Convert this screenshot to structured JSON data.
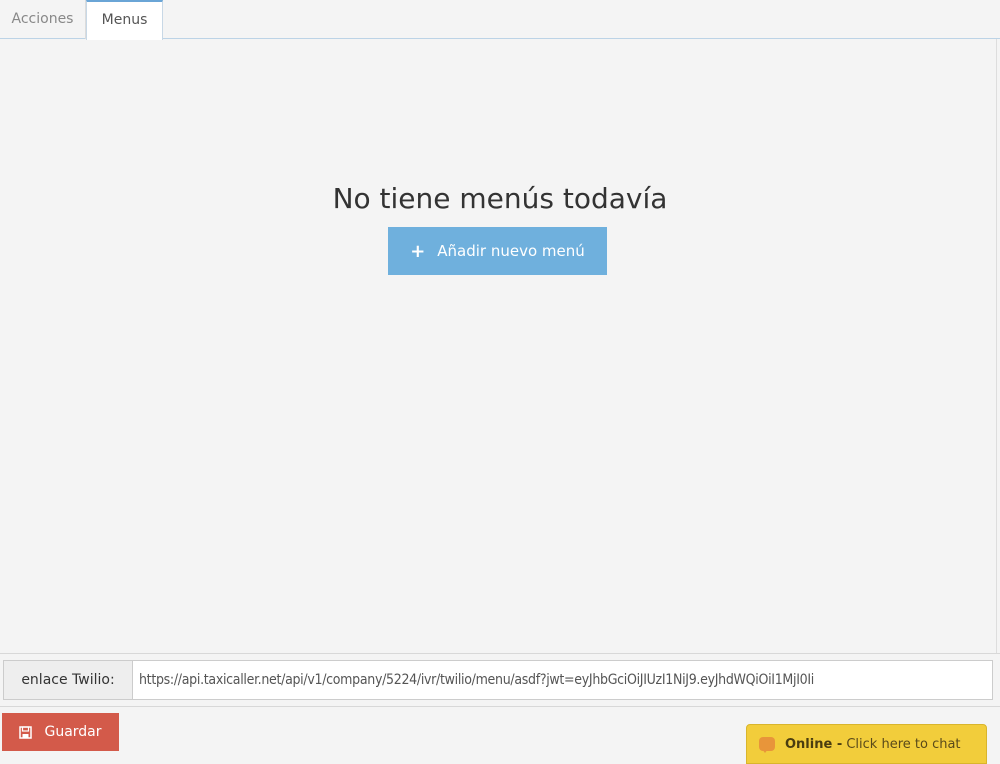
{
  "tabs": [
    {
      "label": "Acciones",
      "active": false
    },
    {
      "label": "Menus",
      "active": true
    }
  ],
  "empty_state": {
    "title": "No tiene menús todavía",
    "add_button": "Añadir nuevo menú",
    "add_icon": "plus-icon"
  },
  "twilio": {
    "label": "enlace Twilio:",
    "value": "https://api.taxicaller.net/api/v1/company/5224/ivr/twilio/menu/asdf?jwt=eyJhbGciOiJIUzI1NiJ9.eyJhdWQiOiI1MjI0Ii"
  },
  "footer": {
    "save_button": "Guardar",
    "save_icon": "floppy-disk-icon"
  },
  "chat": {
    "status": "Online -",
    "cta": "Click here to chat",
    "icon": "chat-bubble-icon"
  }
}
